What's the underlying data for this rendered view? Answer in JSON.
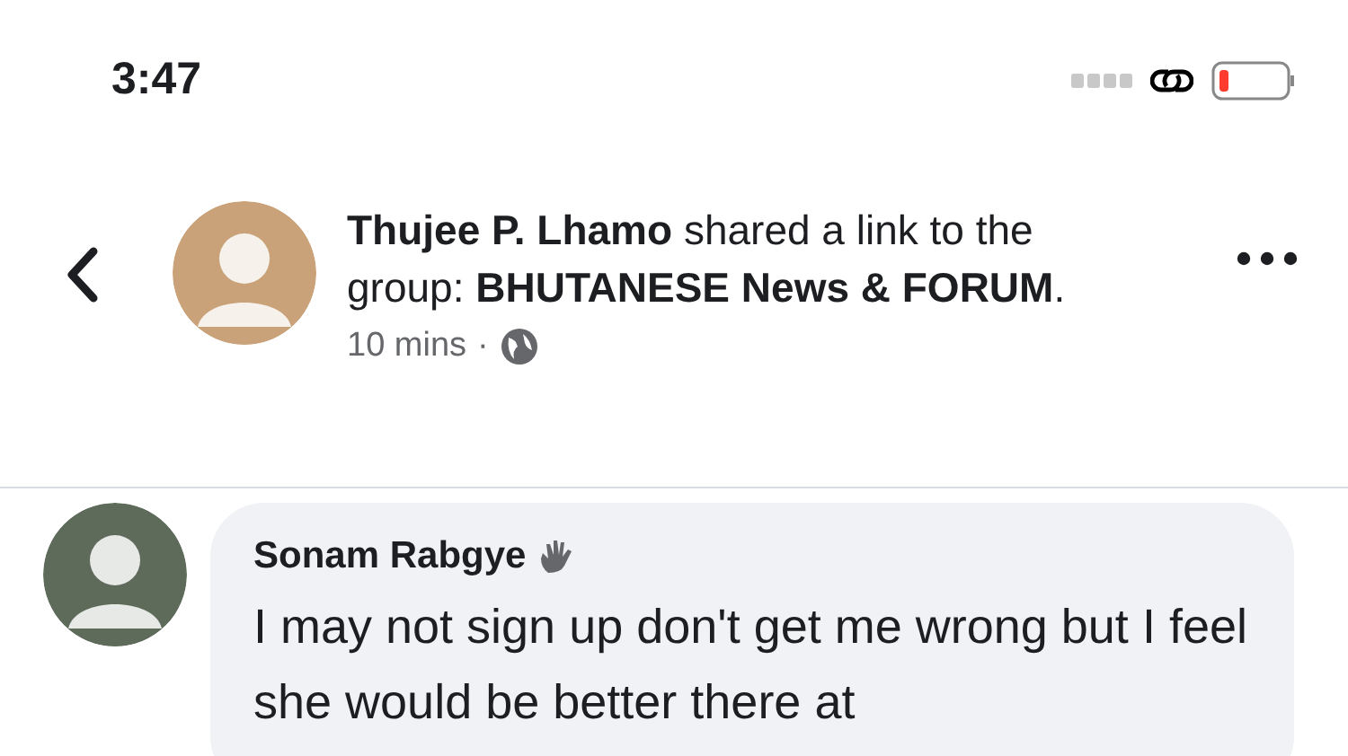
{
  "status_bar": {
    "time": "3:47"
  },
  "post_header": {
    "headline": "**Thujee P. Lhamo** shared a link to the group: **BHUTANESE News & FORUM**.",
    "time": "10 mins",
    "separator": "·"
  },
  "comments": [
    {
      "author": "Sonam Rabgye",
      "text": "I may not sign up don't get me wrong but I feel she would be better there at"
    }
  ]
}
